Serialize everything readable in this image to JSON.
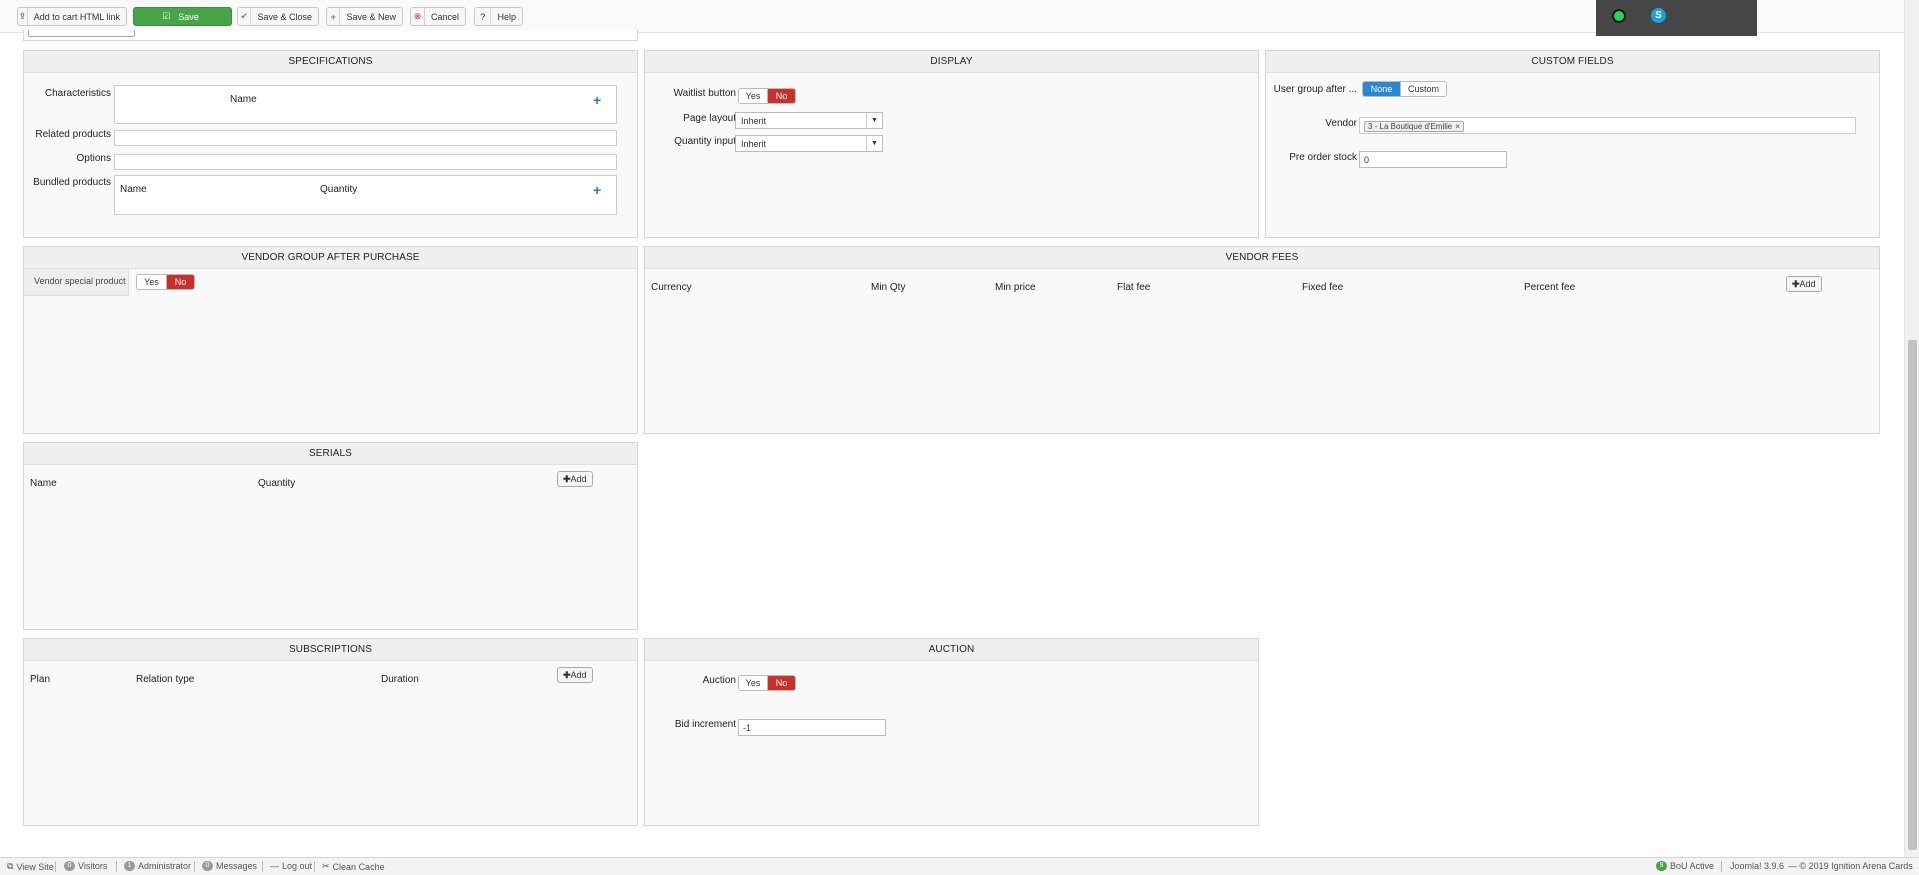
{
  "toolbar": {
    "add_to_cart_link": "Add to cart HTML link",
    "save": "Save",
    "save_close": "Save & Close",
    "save_new": "Save & New",
    "cancel": "Cancel",
    "help": "Help"
  },
  "specifications": {
    "title": "SPECIFICATIONS",
    "characteristics_label": "Characteristics",
    "characteristics_col_name": "Name",
    "related_products_label": "Related products",
    "options_label": "Options",
    "bundled_products_label": "Bundled products",
    "bundled_col_name": "Name",
    "bundled_col_quantity": "Quantity"
  },
  "display": {
    "title": "DISPLAY",
    "waitlist_label": "Waitlist button",
    "waitlist_yes": "Yes",
    "waitlist_no": "No",
    "page_layout_label": "Page layout",
    "page_layout_value": "Inherit",
    "quantity_input_label": "Quantity input",
    "quantity_input_value": "Inherit"
  },
  "custom_fields": {
    "title": "CUSTOM FIELDS",
    "user_group_label": "User group after ...",
    "user_group_none": "None",
    "user_group_custom": "Custom",
    "vendor_label": "Vendor",
    "vendor_tag": "3 - La Boutique d'Emilie",
    "pre_order_label": "Pre order stock",
    "pre_order_value": "0"
  },
  "vendor_group": {
    "title": "VENDOR GROUP AFTER PURCHASE",
    "special_label": "Vendor special product",
    "yes": "Yes",
    "no": "No"
  },
  "vendor_fees": {
    "title": "VENDOR FEES",
    "columns": [
      "Currency",
      "Min Qty",
      "Min price",
      "Flat fee",
      "Fixed fee",
      "Percent fee"
    ],
    "add": "Add"
  },
  "serials": {
    "title": "SERIALS",
    "col_name": "Name",
    "col_quantity": "Quantity",
    "add": "Add"
  },
  "subscriptions": {
    "title": "SUBSCRIPTIONS",
    "col_plan": "Plan",
    "col_relation": "Relation type",
    "col_duration": "Duration",
    "add": "Add"
  },
  "auction": {
    "title": "AUCTION",
    "auction_label": "Auction",
    "yes": "Yes",
    "no": "No",
    "bid_label": "Bid increment",
    "bid_value": "-1"
  },
  "statusbar": {
    "view_site": "View Site",
    "visitors_count": "0",
    "visitors": "Visitors",
    "admin_count": "1",
    "administrator": "Administrator",
    "messages_count": "0",
    "messages": "Messages",
    "logout": "Log out",
    "clean_cache": "Clean Cache",
    "bou_count": "9",
    "bou_active": "BoU Active",
    "joomla_version": "Joomla! 3.9.6",
    "copyright": "— © 2019 Ignition Arena Cards"
  },
  "icons": [
    "upload-icon",
    "save-check-icon",
    "check-icon",
    "plus-icon",
    "cancel-circle-icon",
    "help-question-icon",
    "cloud-icon",
    "skype-icon"
  ],
  "colors": {
    "save_green": "#46a546",
    "no_red": "#c9302c",
    "none_blue": "#2a87d3",
    "plus_blue": "#2a77c7"
  }
}
